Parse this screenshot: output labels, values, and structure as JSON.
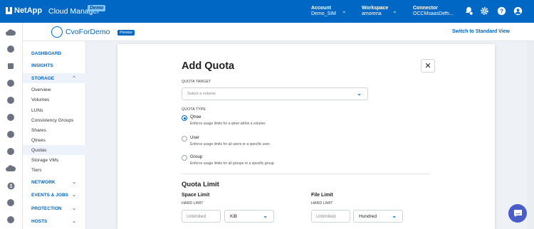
{
  "topbar": {
    "logo": "NetApp",
    "app_name": "Cloud Manager",
    "app_badge": "Demo",
    "account": {
      "label": "Account",
      "value": "Demo_SIM"
    },
    "workspace": {
      "label": "Workspace",
      "value": "amorena"
    },
    "connector": {
      "label": "Connector",
      "value": "OCCMsaasDem..."
    }
  },
  "subheader": {
    "working_env": "CvoForDemo",
    "working_env_badge": "Preview",
    "switch_link": "Switch to Standard View"
  },
  "nav": {
    "dashboard": "DASHBOARD",
    "insights": "INSIGHTS",
    "storage": "STORAGE",
    "storage_items": [
      "Overview",
      "Volumes",
      "LUNs",
      "Consistency Groups",
      "Shares",
      "Qtrees",
      "Quotas",
      "Storage VMs",
      "Tiers"
    ],
    "network": "NETWORK",
    "events_jobs": "EVENTS & JOBS",
    "protection": "PROTECTION",
    "hosts": "HOSTS"
  },
  "dialog": {
    "title": "Add Quota",
    "quota_target_label": "QUOTA TARGET",
    "quota_target_placeholder": "Select a volume",
    "quota_type_label": "QUOTA TYPE",
    "types": [
      {
        "title": "Qtree",
        "desc": "Enforce usage limits for a qtree within a volume.",
        "checked": true
      },
      {
        "title": "User",
        "desc": "Enforce usage limits for all users or a specific user.",
        "checked": false
      },
      {
        "title": "Group",
        "desc": "Enforce usage limits for all groups or a specific group.",
        "checked": false
      }
    ],
    "quota_limit_title": "Quota Limit",
    "space_limit": {
      "title": "Space Limit",
      "hard_limit_label": "HARD LIMIT",
      "value": "Unlimited",
      "unit": "KiB"
    },
    "file_limit": {
      "title": "File Limit",
      "hard_limit_label": "HARD LIMIT",
      "value": "Unlimited",
      "unit": "Hundred"
    }
  },
  "colors": {
    "brand": "#0067c5",
    "chat": "#4a5cc7"
  }
}
